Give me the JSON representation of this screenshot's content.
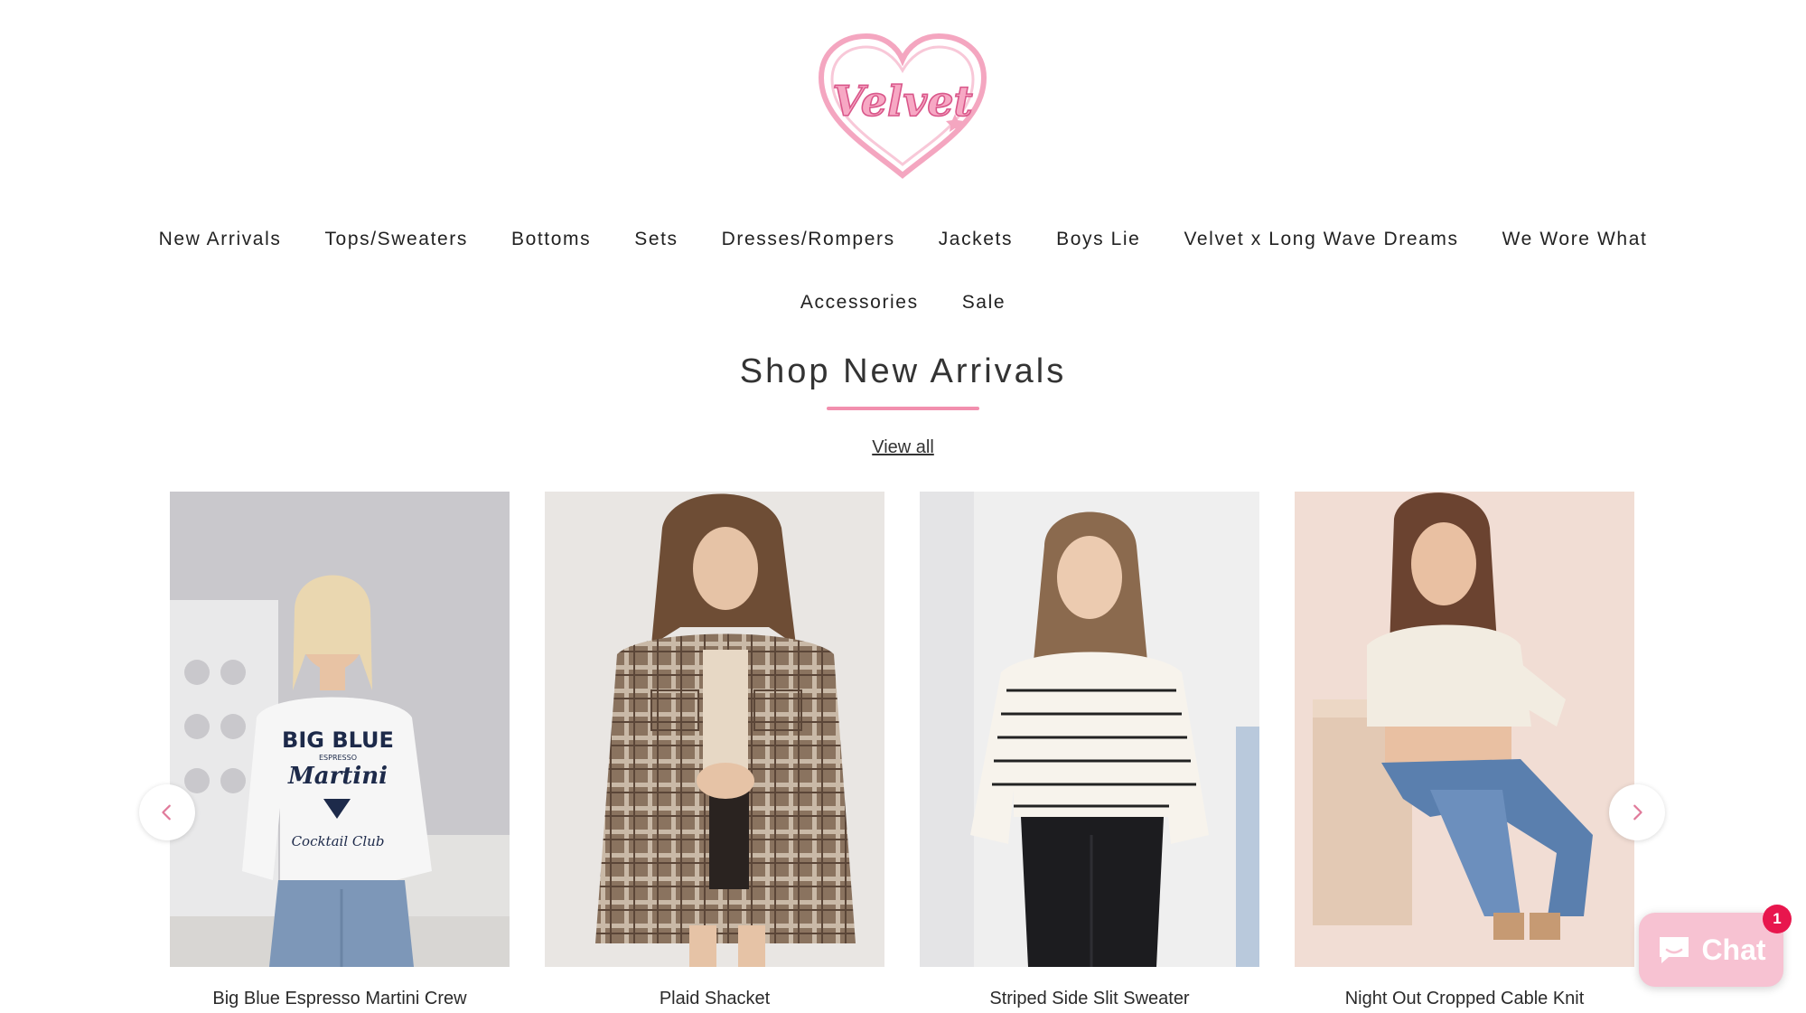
{
  "brand": {
    "logo_text": "Velvet",
    "accent_color": "#f28fae"
  },
  "nav": {
    "row1": [
      "New Arrivals",
      "Tops/Sweaters",
      "Bottoms",
      "Sets",
      "Dresses/Rompers",
      "Jackets",
      "Boys Lie",
      "Velvet x Long Wave Dreams",
      "We Wore What"
    ],
    "row2": [
      "Accessories",
      "Sale"
    ]
  },
  "section": {
    "title": "Shop New Arrivals",
    "view_all": "View all"
  },
  "products": [
    {
      "name": "Big Blue Espresso Martini Crew",
      "shirt_text": [
        "BIG BLUE",
        "ESPRESSO",
        "Martini",
        "Cocktail Club"
      ]
    },
    {
      "name": "Plaid Shacket"
    },
    {
      "name": "Striped Side Slit Sweater"
    },
    {
      "name": "Night Out Cropped Cable Knit"
    }
  ],
  "carousel": {
    "prev_icon": "chevron-left-icon",
    "next_icon": "chevron-right-icon"
  },
  "chat": {
    "label": "Chat",
    "badge": "1",
    "color": "#f7c2d2",
    "badge_color": "#e8164d"
  }
}
